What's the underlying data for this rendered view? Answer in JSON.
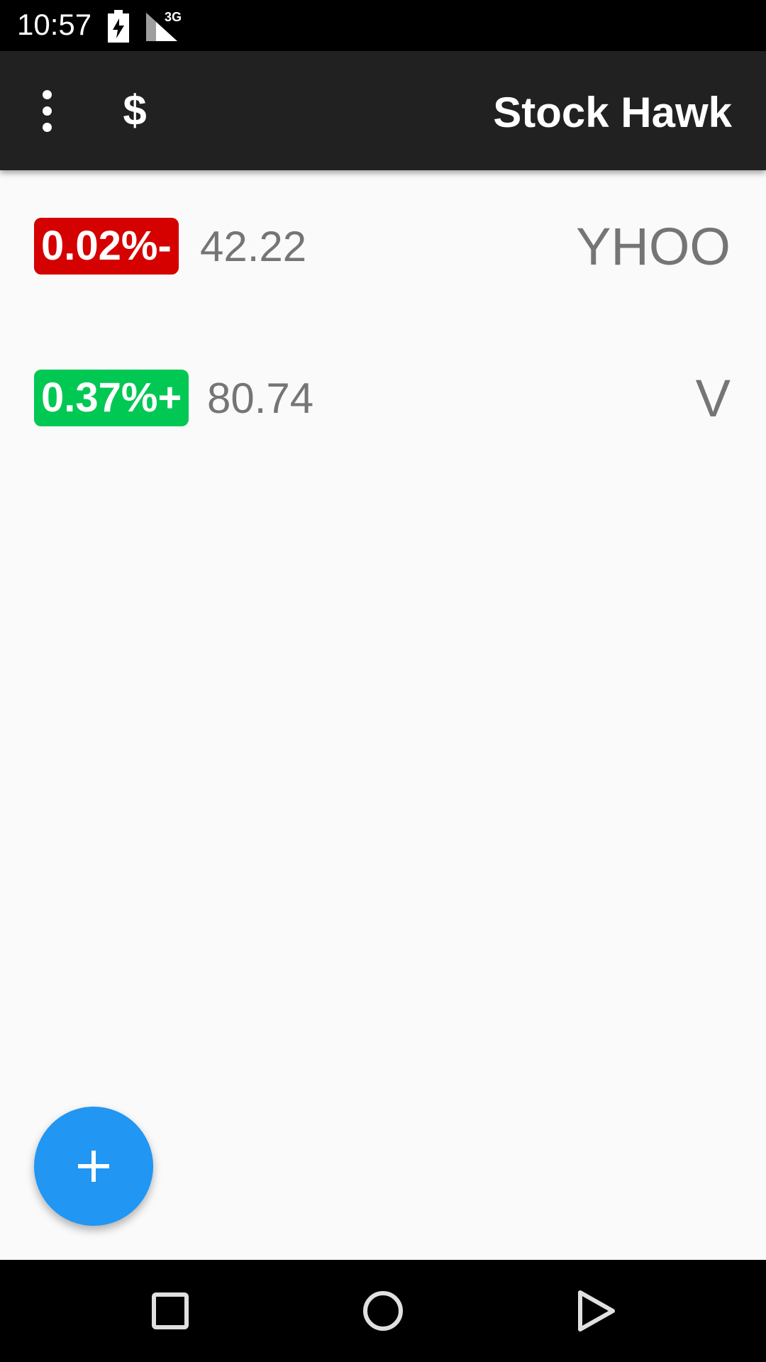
{
  "status_bar": {
    "time": "10:57",
    "network": "3G",
    "icons": [
      "battery-charging-icon",
      "signal-icon"
    ]
  },
  "app_bar": {
    "title": "Stock Hawk",
    "currency_symbol": "$",
    "icons": [
      "overflow-menu-icon",
      "dollar-icon"
    ],
    "background": "#212121"
  },
  "stocks": [
    {
      "change": "0.02%-",
      "price": "42.22",
      "symbol": "YHOO",
      "direction": "down",
      "color": "#d50000"
    },
    {
      "change": "0.37%+",
      "price": "80.74",
      "symbol": "V",
      "direction": "up",
      "color": "#00c853"
    }
  ],
  "fab": {
    "icon": "add-icon",
    "color": "#2196f3"
  },
  "nav_bar": {
    "icons": [
      "recents-icon",
      "home-icon",
      "back-icon"
    ]
  }
}
